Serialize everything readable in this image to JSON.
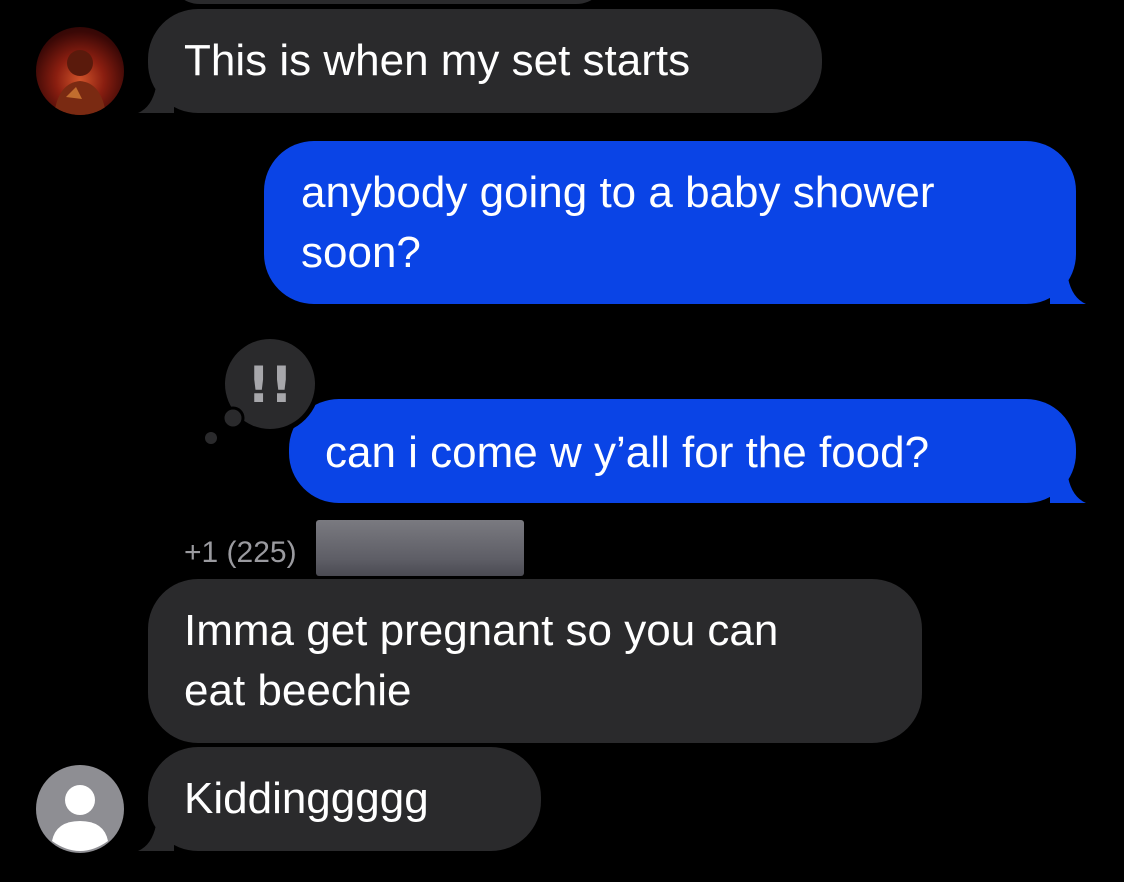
{
  "conversation": {
    "messages": [
      {
        "direction": "incoming",
        "text": "This is when my set starts"
      },
      {
        "direction": "outgoing",
        "lines": [
          "anybody going to a baby shower",
          "soon?"
        ]
      },
      {
        "direction": "outgoing",
        "text": "can i come w y’all for the food?",
        "reaction": "!!"
      },
      {
        "direction": "incoming",
        "sender": "+1 (225)",
        "lines": [
          "Imma get pregnant so you can",
          "eat beechie"
        ]
      },
      {
        "direction": "incoming",
        "text": "Kiddinggggg"
      }
    ]
  },
  "colors": {
    "background": "#000000",
    "incoming_bubble": "#2a2a2c",
    "outgoing_bubble": "#0a44e6",
    "text": "#ffffff",
    "sender_label": "#9a9a9f"
  },
  "icons": {
    "reaction": "exclamation-emphasis-icon",
    "default_avatar": "person-silhouette-icon"
  }
}
